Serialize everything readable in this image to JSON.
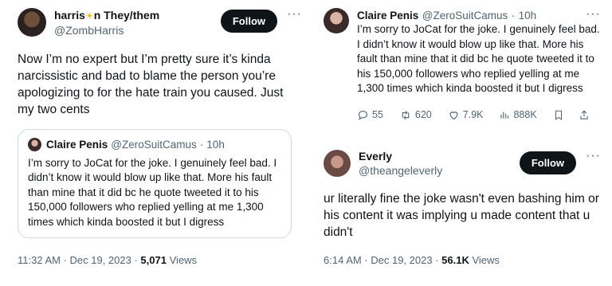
{
  "left": {
    "author_name_before": "harris",
    "author_name_after": "n They/them",
    "author_handle": "@ZombHarris",
    "follow_label": "Follow",
    "more_label": "···",
    "tweet_text": "Now I’m no expert but I’m pretty sure it’s kinda narcissistic and bad to blame the person you’re apologizing to for the hate train you caused. Just my two cents",
    "quote": {
      "name": "Claire Penis",
      "handle": "@ZeroSuitCamus",
      "sep": "·",
      "time": "10h",
      "text": "I’m sorry to JoCat for the joke. I genuinely feel bad. I didn’t know it would blow up like that. More his fault than mine that it did bc he quote tweeted it to his 150,000 followers who replied yelling at me 1,300 times which kinda boosted it but I digress"
    },
    "timestamp": "11:32 AM · Dec 19, 2023 ·",
    "views_count": "5,071",
    "views_label": "Views"
  },
  "right": {
    "original": {
      "name": "Claire Penis",
      "handle": "@ZeroSuitCamus",
      "sep": "·",
      "time": "10h",
      "more_label": "···",
      "text": "I’m sorry to JoCat for the joke. I genuinely feel bad. I didn’t know it would blow up like that. More his fault than mine that it did bc he quote tweeted it to his 150,000 followers who replied yelling at me 1,300 times which kinda boosted it but I digress",
      "replies": "55",
      "retweets": "620",
      "likes": "7.9K",
      "views": "888K"
    },
    "reply": {
      "name": "Everly",
      "handle": "@theangeleverly",
      "follow_label": "Follow",
      "more_label": "···",
      "text": "ur literally fine the joke wasn't even bashing him or his content it was implying u made content that u didn't",
      "timestamp": "6:14 AM · Dec 19, 2023 ·",
      "views_count": "56.1K",
      "views_label": "Views"
    }
  },
  "colors": {
    "text": "#0f1419",
    "muted": "#536471",
    "border": "#cfd9de",
    "button": "#0f1419"
  }
}
